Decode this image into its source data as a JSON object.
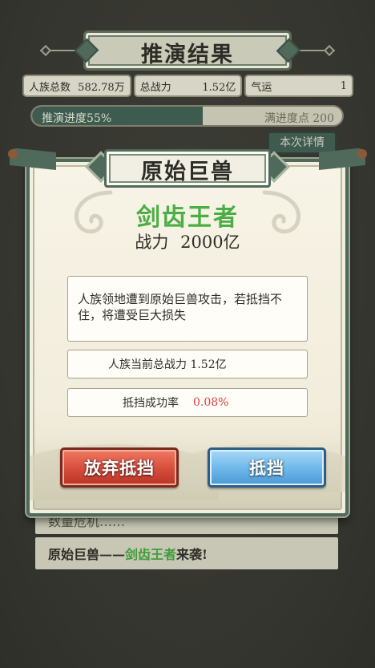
{
  "header": {
    "title": "推演结果"
  },
  "stats": [
    {
      "label": "人族总数",
      "value": "582.78万"
    },
    {
      "label": "总战力",
      "value": "1.52亿"
    },
    {
      "label": "气运",
      "value": "1"
    }
  ],
  "progress": {
    "label": "推演进度55%",
    "percent": 55,
    "right_label": "满进度点 200"
  },
  "detail_button": "本次详情",
  "log": [
    {
      "text": "数量危机……"
    },
    {
      "prefix": "原始巨兽——",
      "highlight": "剑齿王者",
      "suffix": "来袭!"
    }
  ],
  "modal": {
    "title": "原始巨兽",
    "beast_name": "剑齿王者",
    "power_label": "战力",
    "power_value": "2000亿",
    "description": "人族领地遭到原始巨兽攻击，若抵挡不住，将遭受巨大损失",
    "current_power": "人族当前总战力 1.52亿",
    "success_rate_label": "抵挡成功率",
    "success_rate_value": "0.08%",
    "giveup_button": "放弃抵挡",
    "block_button": "抵挡"
  },
  "colors": {
    "accent_green": "#4bae45",
    "rate_red": "#e23a3a",
    "frame": "#4f6a5b"
  }
}
